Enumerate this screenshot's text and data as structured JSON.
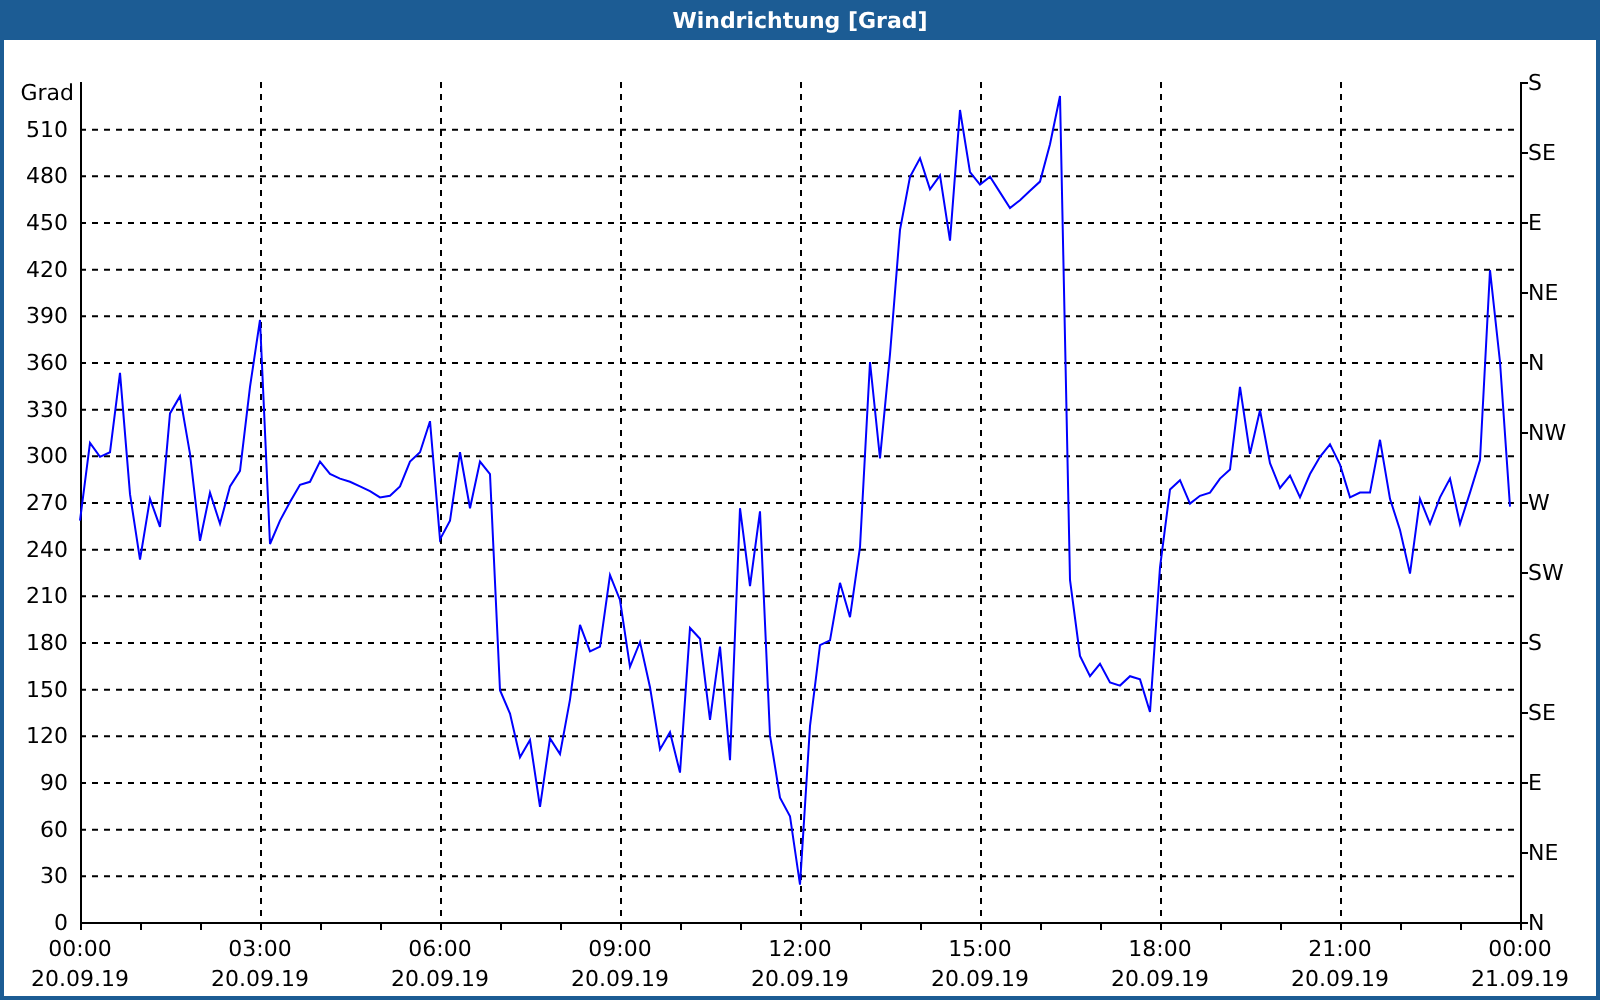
{
  "window": {
    "title": "Windrichtung [Grad]"
  },
  "compass_axis": {
    "labels": [
      "S",
      "SE",
      "E",
      "NE",
      "N",
      "NW",
      "W",
      "SW",
      "S",
      "SE",
      "E",
      "NE",
      "N"
    ]
  },
  "chart_data": {
    "type": "line",
    "grid": true,
    "ylabel": "Grad",
    "ylim": [
      0,
      540
    ],
    "yticks": [
      0,
      30,
      60,
      90,
      120,
      150,
      180,
      210,
      240,
      270,
      300,
      330,
      360,
      390,
      420,
      450,
      480,
      510
    ],
    "categories": [
      "00:00 20.09.19",
      null,
      null,
      null,
      null,
      null,
      null,
      null,
      null,
      null,
      null,
      null,
      null,
      null,
      null,
      null,
      null,
      null,
      "03:00 20.09.19",
      null,
      null,
      null,
      null,
      null,
      null,
      null,
      null,
      null,
      null,
      null,
      null,
      null,
      null,
      null,
      null,
      null,
      "06:00 20.09.19",
      null,
      null,
      null,
      null,
      null,
      null,
      null,
      null,
      null,
      null,
      null,
      null,
      null,
      null,
      null,
      null,
      null,
      "09:00 20.09.19",
      null,
      null,
      null,
      null,
      null,
      null,
      null,
      null,
      null,
      null,
      null,
      null,
      null,
      null,
      null,
      null,
      null,
      "12:00 20.09.19",
      null,
      null,
      null,
      null,
      null,
      null,
      null,
      null,
      null,
      null,
      null,
      null,
      null,
      null,
      null,
      null,
      null,
      "15:00 20.09.19",
      null,
      null,
      null,
      null,
      null,
      null,
      null,
      null,
      null,
      null,
      null,
      null,
      null,
      null,
      null,
      null,
      null,
      "18:00 20.09.19",
      null,
      null,
      null,
      null,
      null,
      null,
      null,
      null,
      null,
      null,
      null,
      null,
      null,
      null,
      null,
      null,
      null,
      "21:00 20.09.19",
      null,
      null,
      null,
      null,
      null,
      null,
      null,
      null,
      null,
      null,
      null,
      null,
      null,
      null,
      null,
      null,
      null,
      "00:00 21.09.19"
    ],
    "series": [
      {
        "color": "#0000ff",
        "values": [
          258,
          308,
          299,
          302,
          353,
          275,
          233,
          272,
          254,
          327,
          338,
          301,
          245,
          276,
          256,
          280,
          290,
          344,
          387,
          243,
          258,
          270,
          281,
          283,
          296,
          288,
          285,
          283,
          280,
          277,
          273,
          274,
          280,
          296,
          302,
          322,
          246,
          258,
          302,
          266,
          296,
          288,
          149,
          134,
          106,
          117,
          74,
          118,
          108,
          143,
          191,
          174,
          177,
          223,
          207,
          164,
          180,
          151,
          111,
          122,
          96,
          189,
          182,
          130,
          177,
          104,
          266,
          216,
          264,
          120,
          80,
          68,
          24,
          126,
          178,
          181,
          218,
          196,
          241,
          360,
          298,
          365,
          445,
          479,
          491,
          471,
          480,
          438,
          522,
          482,
          474,
          479,
          469,
          459,
          464,
          470,
          476,
          500,
          531,
          220,
          171,
          158,
          166,
          154,
          152,
          158,
          156,
          135,
          228,
          278,
          284,
          269,
          274,
          276,
          285,
          291,
          344,
          301,
          329,
          295,
          279,
          287,
          273,
          288,
          299,
          307,
          294,
          273,
          276,
          276,
          310,
          272,
          252,
          224,
          272,
          256,
          273,
          285,
          256,
          276,
          297,
          419,
          360,
          267,
          null
        ]
      }
    ]
  }
}
